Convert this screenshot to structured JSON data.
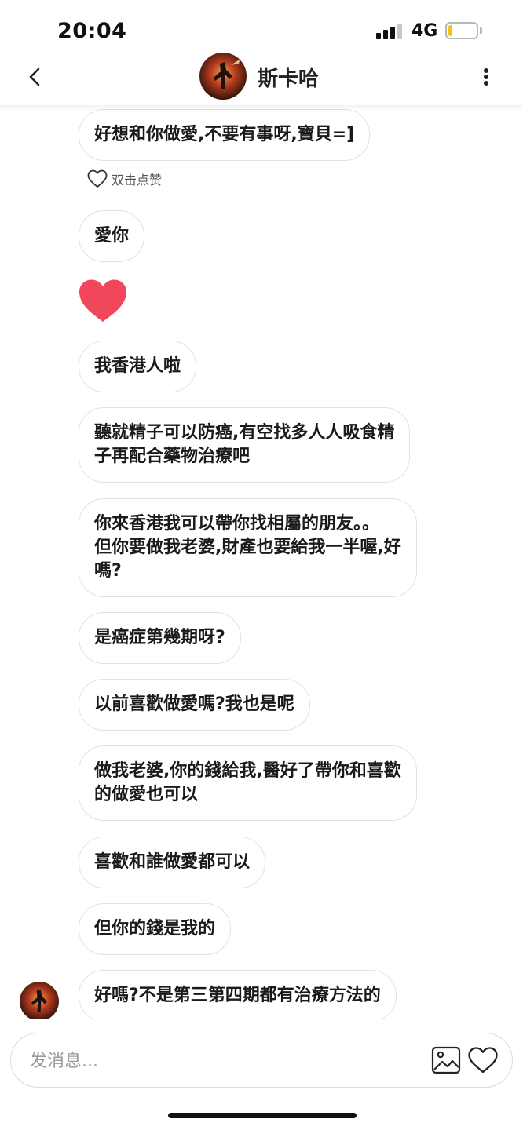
{
  "status_bar": {
    "time": "20:04",
    "network": "4G",
    "signal_bars": 3,
    "signal_bars_total": 4,
    "battery_level": 0.15,
    "battery_color": "#f2c418"
  },
  "header": {
    "title": "斯卡哈",
    "back_icon": "chevron-left-icon",
    "more_icon": "vertical-dots-icon"
  },
  "like_hint": {
    "label": "双击点赞",
    "icon": "heart-outline-icon"
  },
  "messages": [
    {
      "text": "好想和你做愛,不要有事呀,寶貝=]"
    },
    {
      "text": "愛你"
    },
    {
      "emoji": "red-heart-icon",
      "color": "#f0485a"
    },
    {
      "text": "我香港人啦"
    },
    {
      "text": "聽就精子可以防癌,有空找多人人吸食精\n子再配合藥物治療吧"
    },
    {
      "text": "你來香港我可以帶你找相屬的朋友。。\n但你要做我老婆,財產也要給我一半喔,好\n嗎?"
    },
    {
      "text": "是癌症第幾期呀?"
    },
    {
      "text": "以前喜歡做愛嗎?我也是呢"
    },
    {
      "text": "做我老婆,你的錢給我,醫好了帶你和喜歡\n的做愛也可以"
    },
    {
      "text": "喜歡和誰做愛都可以"
    },
    {
      "text": "但你的錢是我的"
    },
    {
      "text": "好嗎?不是第三第四期都有治療方法的"
    }
  ],
  "composer": {
    "placeholder": "发消息...",
    "gallery_icon": "image-gallery-icon",
    "heart_icon": "heart-outline-icon"
  }
}
